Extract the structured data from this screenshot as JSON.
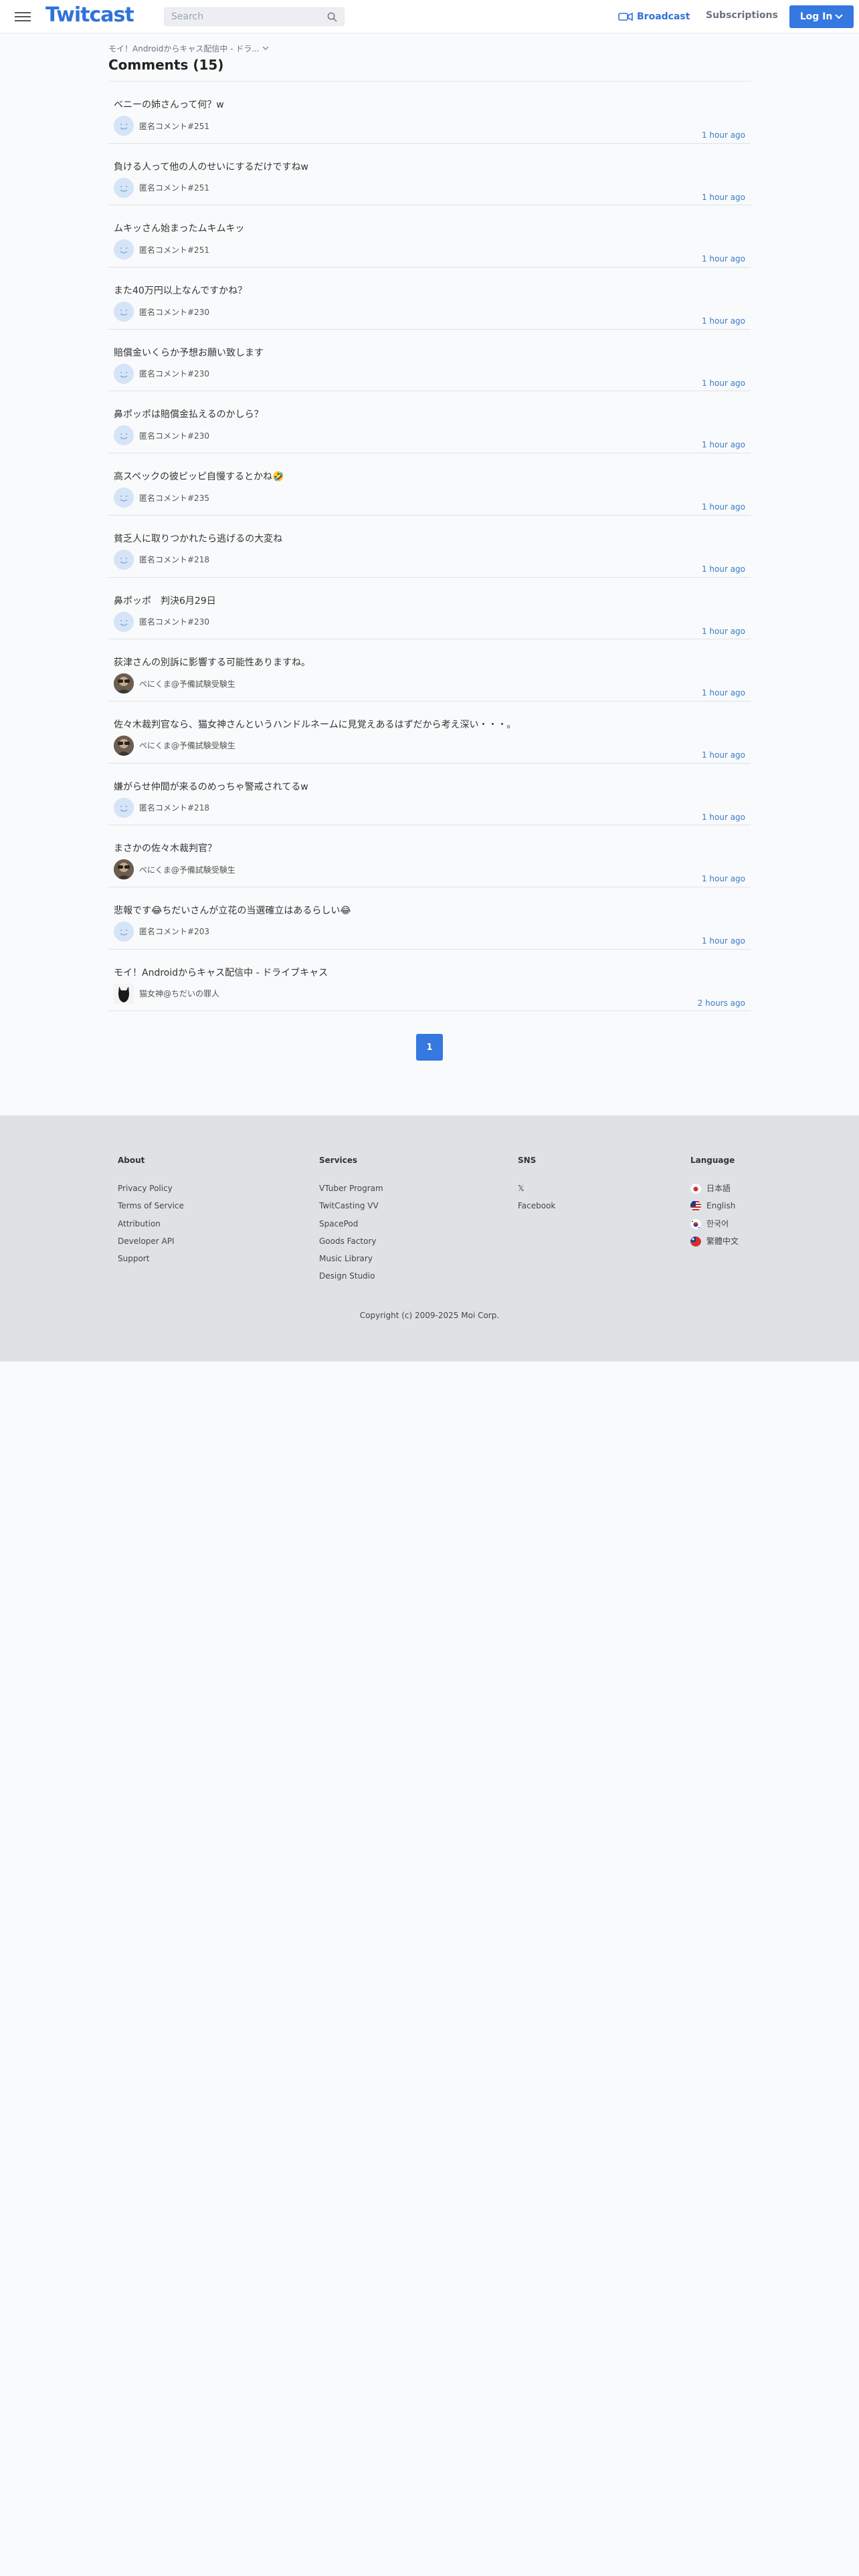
{
  "header": {
    "logo": "Twitcast",
    "search_placeholder": "Search",
    "broadcast_label": "Broadcast",
    "subscriptions_label": "Subscriptions",
    "login_label": "Log In"
  },
  "breadcrumb": "モイ！Androidからキャス配信中 - ドラ...",
  "page_title": "Comments (15)",
  "comments": [
    {
      "text": "ベニーの姉さんって何？w",
      "user": "匿名コメント#251",
      "time": "1 hour ago",
      "avatar": "default"
    },
    {
      "text": "負ける人って他の人のせいにするだけですねw",
      "user": "匿名コメント#251",
      "time": "1 hour ago",
      "avatar": "default"
    },
    {
      "text": "ムキッさん始まったムキムキッ",
      "user": "匿名コメント#251",
      "time": "1 hour ago",
      "avatar": "default"
    },
    {
      "text": "また40万円以上なんですかね？",
      "user": "匿名コメント#230",
      "time": "1 hour ago",
      "avatar": "default"
    },
    {
      "text": "賠償金いくらか予想お願い致します",
      "user": "匿名コメント#230",
      "time": "1 hour ago",
      "avatar": "default"
    },
    {
      "text": "鼻ポッポは賠償金払えるのかしら？",
      "user": "匿名コメント#230",
      "time": "1 hour ago",
      "avatar": "default"
    },
    {
      "text": "高スペックの彼ピッピ自慢するとかね🤣",
      "user": "匿名コメント#235",
      "time": "1 hour ago",
      "avatar": "default"
    },
    {
      "text": "貧乏人に取りつかれたら逃げるの大変ね",
      "user": "匿名コメント#218",
      "time": "1 hour ago",
      "avatar": "default"
    },
    {
      "text": "鼻ポッポ　判決6月29日",
      "user": "匿名コメント#230",
      "time": "1 hour ago",
      "avatar": "default"
    },
    {
      "text": "荻津さんの別訴に影響する可能性ありますね。",
      "user": "ぺにくま@予備試験受験生",
      "time": "1 hour ago",
      "avatar": "photo"
    },
    {
      "text": "佐々木裁判官なら、猫女神さんというハンドルネームに見覚えあるはずだから考え深い・・・。",
      "user": "ぺにくま@予備試験受験生",
      "time": "1 hour ago",
      "avatar": "photo"
    },
    {
      "text": "嫌がらせ仲間が来るのめっちゃ警戒されてるw",
      "user": "匿名コメント#218",
      "time": "1 hour ago",
      "avatar": "default"
    },
    {
      "text": "まさかの佐々木裁判官？",
      "user": "ぺにくま@予備試験受験生",
      "time": "1 hour ago",
      "avatar": "photo"
    },
    {
      "text": "悲報です😂ちだいさんが立花の当選確立はあるらしい😂",
      "user": "匿名コメント#203",
      "time": "1 hour ago",
      "avatar": "default"
    },
    {
      "text": "モイ！Androidからキャス配信中 - ドライブキャス",
      "user": "猫女神@ちだいの罪人",
      "time": "2 hours ago",
      "avatar": "dark"
    }
  ],
  "pagination": {
    "current": "1"
  },
  "footer": {
    "about": {
      "title": "About",
      "links": [
        "Privacy Policy",
        "Terms of Service",
        "Attribution",
        "Developer API",
        "Support"
      ]
    },
    "services": {
      "title": "Services",
      "links": [
        "VTuber Program",
        "TwitCasting VV",
        "SpacePod",
        "Goods Factory",
        "Music Library",
        "Design Studio"
      ]
    },
    "sns": {
      "title": "SNS",
      "links": [
        "𝕏",
        "Facebook"
      ]
    },
    "language": {
      "title": "Language",
      "items": [
        {
          "label": "日本語",
          "flag": "jp"
        },
        {
          "label": "English",
          "flag": "us"
        },
        {
          "label": "한국어",
          "flag": "kr"
        },
        {
          "label": "繁體中文",
          "flag": "tw"
        }
      ]
    },
    "copyright": "Copyright (c) 2009-2025 Moi Corp."
  },
  "colors": {
    "accent": "#3478e0",
    "link": "#3b7ac9",
    "footer_bg": "#dfe2e5"
  }
}
